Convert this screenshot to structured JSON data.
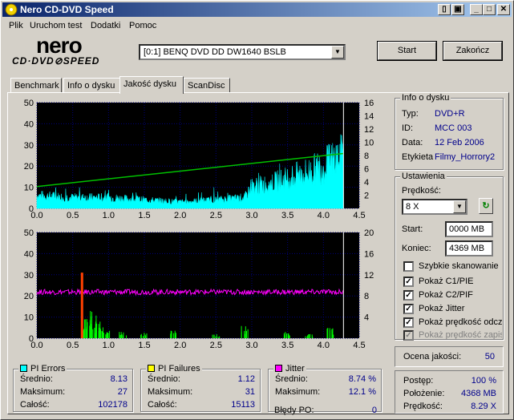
{
  "window": {
    "title": "Nero CD-DVD Speed",
    "title_icon": "disc-icon",
    "colors": {
      "title_start": "#0a246a",
      "title_end": "#a6caf0"
    }
  },
  "menu": [
    "Plik",
    "Uruchom test",
    "Dodatki",
    "Pomoc"
  ],
  "logo": {
    "line1": "nero",
    "line2": "CD·DVD⊘SPEED"
  },
  "drive": {
    "selected": "[0:1]  BENQ DVD DD DW1640 BSLB"
  },
  "buttons": {
    "start": "Start",
    "end": "Zakończ"
  },
  "tabs": [
    "Benchmark",
    "Info o dysku",
    "Jakość dysku",
    "ScanDisc"
  ],
  "active_tab": "Jakość dysku",
  "disc_info": {
    "title": "Info o dysku",
    "rows": [
      {
        "label": "Typ:",
        "value": "DVD+R"
      },
      {
        "label": "ID:",
        "value": "MCC 003"
      },
      {
        "label": "Data:",
        "value": "12 Feb 2006"
      },
      {
        "label": "Etykieta",
        "value": "Filmy_Horrory2"
      }
    ]
  },
  "settings": {
    "title": "Ustawienia",
    "speed_label": "Prędkość:",
    "speed_value": "8 X",
    "start_label": "Start:",
    "start_value": "0000 MB",
    "end_label": "Koniec:",
    "end_value": "4369 MB",
    "checkboxes": [
      {
        "label": "Szybkie skanowanie",
        "checked": false,
        "disabled": false
      },
      {
        "label": "Pokaż C1/PIE",
        "checked": true,
        "disabled": false
      },
      {
        "label": "Pokaż C2/PIF",
        "checked": true,
        "disabled": false
      },
      {
        "label": "Pokaż Jitter",
        "checked": true,
        "disabled": false
      },
      {
        "label": "Pokaż prędkość odczytu",
        "checked": true,
        "disabled": false
      },
      {
        "label": "Pokaż prędkość zapisu",
        "checked": true,
        "disabled": true
      }
    ]
  },
  "quality": {
    "label": "Ocena jakości:",
    "value": "50"
  },
  "pi_errors": {
    "title": "PI Errors",
    "color": "#00ffff",
    "rows": [
      {
        "label": "Średnio:",
        "value": "8.13"
      },
      {
        "label": "Maksimum:",
        "value": "27"
      },
      {
        "label": "Całość:",
        "value": "102178"
      }
    ]
  },
  "pi_failures": {
    "title": "PI Failures",
    "color": "#ffff00",
    "rows": [
      {
        "label": "Średnio:",
        "value": "1.12"
      },
      {
        "label": "Maksimum:",
        "value": "31"
      },
      {
        "label": "Całość:",
        "value": "15113"
      }
    ]
  },
  "jitter": {
    "title": "Jitter",
    "color": "#ff00ff",
    "rows": [
      {
        "label": "Średnio:",
        "value": "8.74 %"
      },
      {
        "label": "Maksimum:",
        "value": "12.1 %"
      }
    ],
    "po_label": "Błędy PO:",
    "po_value": "0"
  },
  "progress": {
    "rows": [
      {
        "label": "Postęp:",
        "value": "100 %"
      },
      {
        "label": "Położenie:",
        "value": "4368 MB"
      },
      {
        "label": "Prędkość:",
        "value": "8.29 X"
      }
    ]
  },
  "chart_data": [
    {
      "type": "area",
      "description": "PI errors (cyan) with read speed (green line)",
      "x_ticks": [
        "0.0",
        "0.5",
        "1.0",
        "1.5",
        "2.0",
        "2.5",
        "3.0",
        "3.5",
        "4.0",
        "4.5"
      ],
      "y_left_ticks": [
        "0",
        "10",
        "20",
        "30",
        "40",
        "50"
      ],
      "y_right_ticks": [
        "2",
        "4",
        "6",
        "8",
        "10",
        "12",
        "14",
        "16"
      ],
      "xlim": [
        0,
        4.5
      ],
      "ylim_left": [
        0,
        50
      ],
      "ylim_right": [
        0,
        16
      ],
      "pie_profile": {
        "x": [
          0.0,
          0.5,
          1.0,
          1.5,
          2.0,
          2.5,
          2.9,
          3.0,
          3.3,
          3.5,
          3.8,
          4.0,
          4.2,
          4.28
        ],
        "y": [
          6,
          5,
          5,
          4,
          3,
          4,
          5,
          10,
          12,
          14,
          17,
          20,
          24,
          25
        ]
      },
      "speed": {
        "x": [
          0.0,
          4.28
        ],
        "y": [
          3.3,
          8.3
        ]
      },
      "marker_x": 4.28,
      "colors": {
        "pie": "#00ffff",
        "speed": "#00c000"
      }
    },
    {
      "type": "bar",
      "description": "PI failures (green/yellow) with jitter (magenta)",
      "x_ticks": [
        "0.0",
        "0.5",
        "1.0",
        "1.5",
        "2.0",
        "2.5",
        "3.0",
        "3.5",
        "4.0",
        "4.5"
      ],
      "y_left_ticks": [
        "0",
        "10",
        "20",
        "30",
        "40",
        "50"
      ],
      "y_right_ticks": [
        "4",
        "8",
        "12",
        "16",
        "20"
      ],
      "xlim": [
        0,
        4.5
      ],
      "ylim_left": [
        0,
        50
      ],
      "ylim_right": [
        0,
        20
      ],
      "jitter_avg": 8.74,
      "pif_spike": {
        "x": 0.63,
        "y": 31
      },
      "pif_clusters": [
        {
          "x": 0.68,
          "y": 10
        },
        {
          "x": 0.72,
          "y": 13
        },
        {
          "x": 0.78,
          "y": 11
        },
        {
          "x": 0.85,
          "y": 8
        },
        {
          "x": 0.9,
          "y": 6
        },
        {
          "x": 1.0,
          "y": 4
        },
        {
          "x": 1.2,
          "y": 3
        },
        {
          "x": 1.5,
          "y": 3
        },
        {
          "x": 1.9,
          "y": 5
        },
        {
          "x": 2.5,
          "y": 2
        },
        {
          "x": 2.9,
          "y": 6
        },
        {
          "x": 3.5,
          "y": 3
        },
        {
          "x": 3.8,
          "y": 2
        },
        {
          "x": 4.1,
          "y": 5
        }
      ],
      "marker_x": 4.28,
      "colors": {
        "pif": "#00ff00",
        "jitter": "#ff00ff",
        "spike": "#ff4000"
      }
    }
  ]
}
